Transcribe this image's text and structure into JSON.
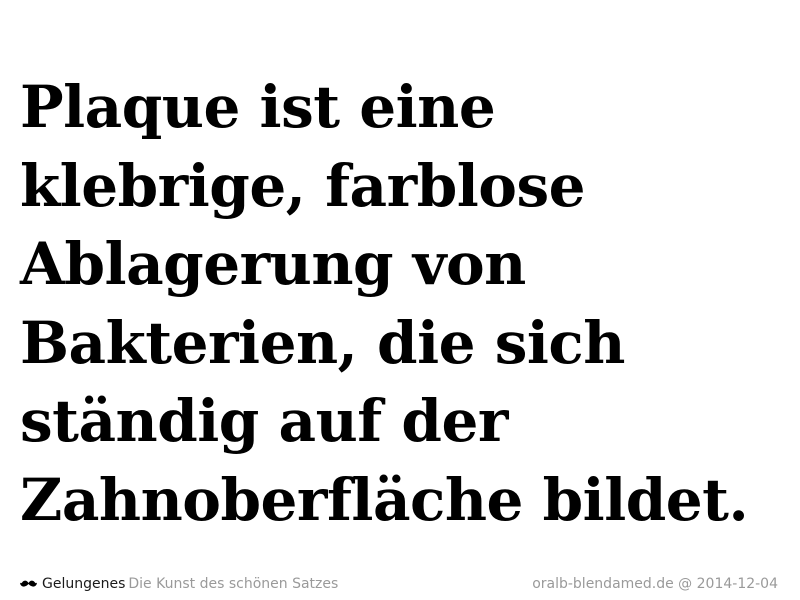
{
  "quote": {
    "lines": [
      "Plaque ist eine",
      "klebrige, farblose",
      "Ablagerung von",
      "Bakterien, die sich",
      "ständig auf der",
      "Zahnoberfläche bildet."
    ]
  },
  "footer": {
    "logo_icon": "mustache-icon",
    "brand": "Gelungenes",
    "tagline": "Die Kunst des schönen Satzes",
    "source": "oralb-blendamed.de @ 2014-12-04"
  },
  "colors": {
    "text": "#000000",
    "muted": "#9a9a9a",
    "background": "#ffffff"
  }
}
